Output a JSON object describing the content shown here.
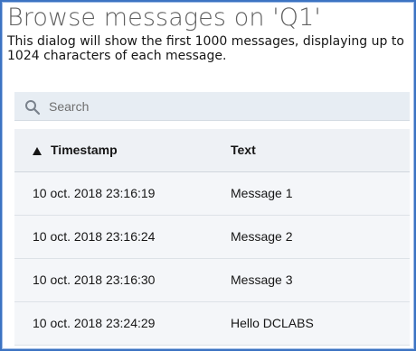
{
  "dialog": {
    "title": "Browse messages on 'Q1'",
    "description": "This dialog will show the first 1000 messages, displaying up to 1024 characters of each message."
  },
  "search": {
    "placeholder": "Search",
    "value": "",
    "icon": "search-icon"
  },
  "table": {
    "columns": {
      "timestamp": "Timestamp",
      "text": "Text"
    },
    "sort": {
      "column": "timestamp",
      "direction": "ascending",
      "icon": "sort-ascending-icon"
    },
    "rows": [
      {
        "timestamp": "10 oct. 2018 23:16:19",
        "text": "Message 1"
      },
      {
        "timestamp": "10 oct. 2018 23:16:24",
        "text": "Message 2"
      },
      {
        "timestamp": "10 oct. 2018 23:16:30",
        "text": "Message 3"
      },
      {
        "timestamp": "10 oct. 2018 23:24:29",
        "text": "Hello DCLABS"
      }
    ]
  },
  "colors": {
    "frame_border": "#3c73c2",
    "title_text": "#606060",
    "search_background": "#e7edf3",
    "table_background": "#f4f6f9"
  }
}
